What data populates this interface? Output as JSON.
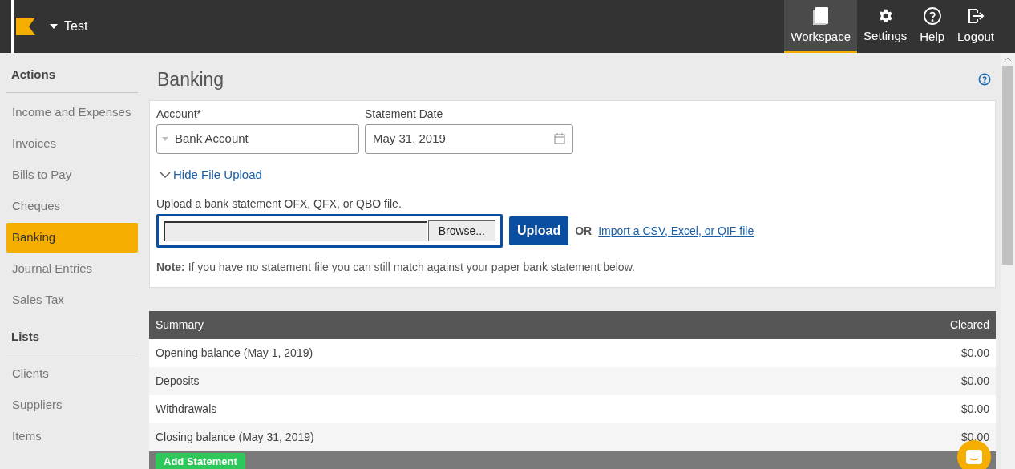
{
  "header": {
    "org": "Test",
    "nav": [
      {
        "kind": "book",
        "label": "Workspace",
        "selected": true
      },
      {
        "kind": "gear",
        "label": "Settings",
        "selected": false
      },
      {
        "kind": "help",
        "label": "Help",
        "selected": false
      },
      {
        "kind": "logout",
        "label": "Logout",
        "selected": false
      }
    ]
  },
  "sidebar": {
    "sections": [
      {
        "title": "Actions",
        "items": [
          {
            "label": "Income and Expenses",
            "selected": false
          },
          {
            "label": "Invoices",
            "selected": false
          },
          {
            "label": "Bills to Pay",
            "selected": false
          },
          {
            "label": "Cheques",
            "selected": false
          },
          {
            "label": "Banking",
            "selected": true
          },
          {
            "label": "Journal Entries",
            "selected": false
          },
          {
            "label": "Sales Tax",
            "selected": false
          }
        ]
      },
      {
        "title": "Lists",
        "items": [
          {
            "label": "Clients",
            "selected": false
          },
          {
            "label": "Suppliers",
            "selected": false
          },
          {
            "label": "Items",
            "selected": false
          }
        ]
      }
    ]
  },
  "page": {
    "title": "Banking",
    "form": {
      "account": {
        "label": "Account*",
        "value": "Bank Account"
      },
      "date": {
        "label": "Statement Date",
        "value": "May 31, 2019"
      },
      "toggle": {
        "label": "Hide File Upload",
        "expanded": true
      },
      "upload_hint": "Upload a bank statement OFX, QFX, or QBO file.",
      "browse": "Browse...",
      "upload": "Upload",
      "or": "OR",
      "import_link": "Import a CSV, Excel, or QIF file",
      "note": "**Note:** If you have no statement file you can still match against your paper bank statement below."
    },
    "summary": {
      "columns": [
        "Summary",
        "Cleared"
      ],
      "rows": [
        [
          "Opening balance (May 1, 2019)",
          "$0.00"
        ],
        [
          "Deposits",
          "$0.00"
        ],
        [
          "Withdrawals",
          "$0.00"
        ],
        [
          "Closing balance (May 31, 2019)",
          "$0.00"
        ]
      ]
    },
    "add_button": "Add Statement"
  }
}
